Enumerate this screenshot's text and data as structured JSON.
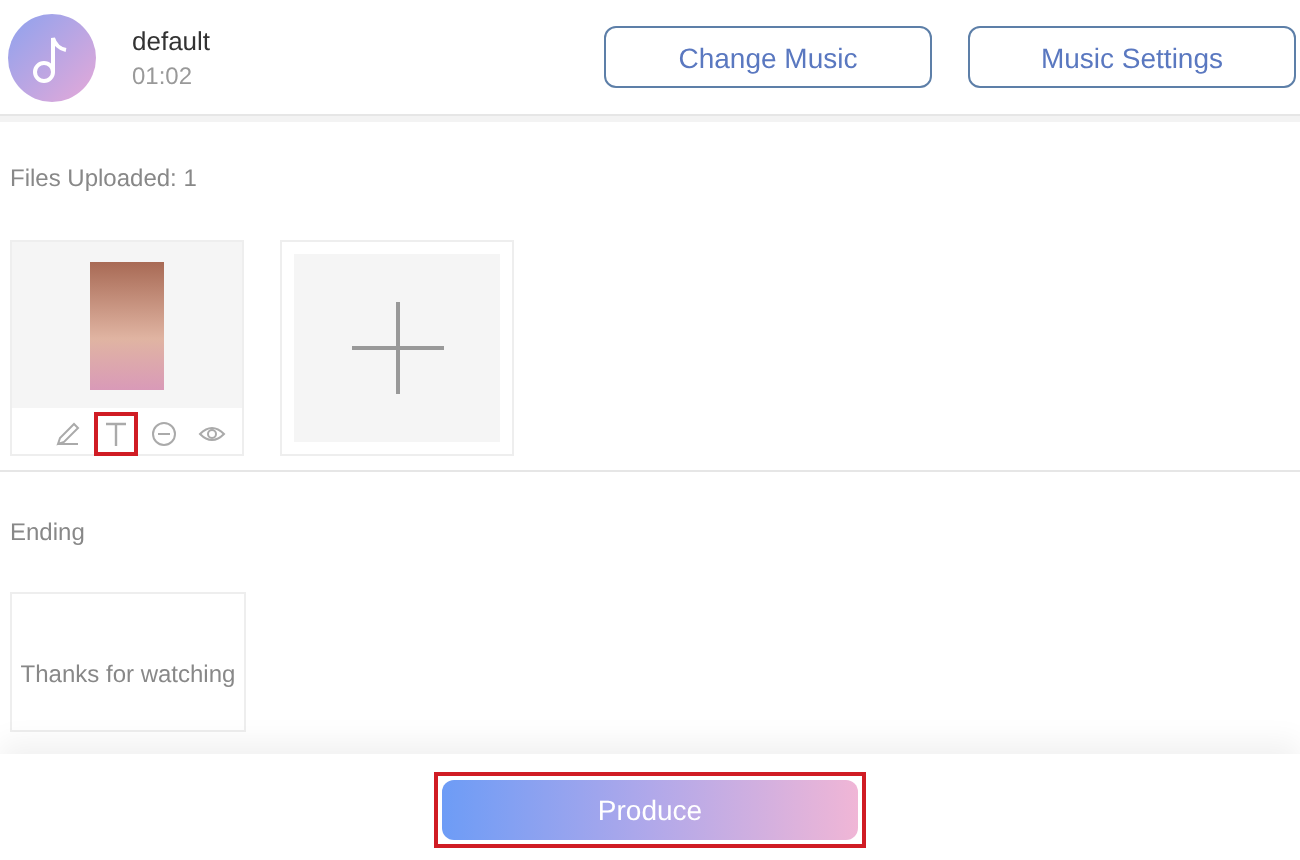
{
  "music": {
    "title": "default",
    "duration": "01:02"
  },
  "header_buttons": [
    "Change Music",
    "Music Settings"
  ],
  "files_label": "Files Uploaded: 1",
  "file_tools": [
    {
      "kind": "edit",
      "highlighted": false
    },
    {
      "kind": "text",
      "highlighted": true
    },
    {
      "kind": "remove",
      "highlighted": false
    },
    {
      "kind": "preview",
      "highlighted": false
    }
  ],
  "ending": {
    "label": "Ending",
    "card_text": "Thanks for watching"
  },
  "produce": {
    "label": "Produce",
    "highlighted": true
  }
}
